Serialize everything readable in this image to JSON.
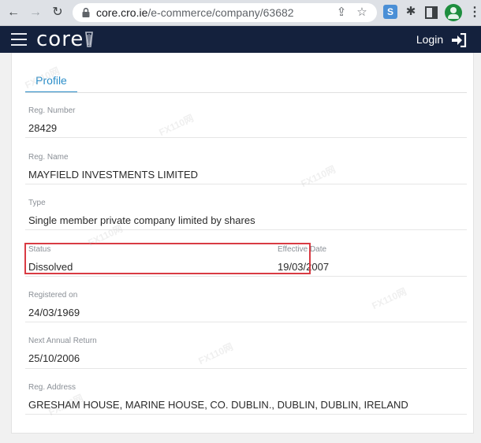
{
  "browser": {
    "url_domain": "core.cro.ie",
    "url_path": "/e-commerce/company/63682",
    "extension_label": "S"
  },
  "app": {
    "brand": "core",
    "login_label": "Login"
  },
  "tabs": [
    {
      "label": "Profile",
      "active": true
    }
  ],
  "fields": {
    "reg_number": {
      "label": "Reg. Number",
      "value": "28429"
    },
    "reg_name": {
      "label": "Reg. Name",
      "value": "MAYFIELD INVESTMENTS LIMITED"
    },
    "type": {
      "label": "Type",
      "value": "Single member private company limited by shares"
    },
    "status": {
      "label": "Status",
      "value": "Dissolved"
    },
    "effective_date": {
      "label": "Effective Date",
      "value": "19/03/2007"
    },
    "registered_on": {
      "label": "Registered on",
      "value": "24/03/1969"
    },
    "next_annual_return": {
      "label": "Next Annual Return",
      "value": "25/10/2006"
    },
    "reg_address": {
      "label": "Reg. Address",
      "value": "GRESHAM HOUSE, MARINE HOUSE, CO. DUBLIN., DUBLIN, DUBLIN, IRELAND"
    }
  },
  "colors": {
    "appbar": "#14213d",
    "accent": "#2b8ec9",
    "highlight": "#d93b43"
  },
  "watermark_text": "FX110网"
}
